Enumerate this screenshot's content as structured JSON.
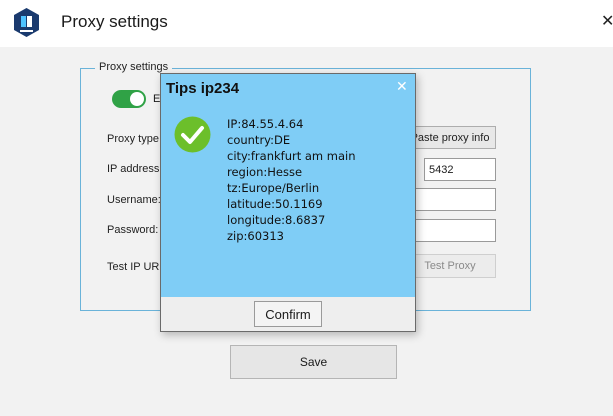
{
  "window": {
    "title": "Proxy settings",
    "close_glyph": "✕"
  },
  "groupbox": {
    "legend": "Proxy settings"
  },
  "form": {
    "toggle_label": "E",
    "toggle_on": true,
    "proxy_type_label": "Proxy type",
    "paste_button": "Paste proxy info",
    "ip_label": "IP address",
    "port_value": "5432",
    "username_label": "Username:",
    "password_label": "Password:",
    "test_url_label": "Test IP URL",
    "test_button": "Test Proxy"
  },
  "save_button": "Save",
  "dialog": {
    "title": "Tips ip234",
    "close_glyph": "✕",
    "icon": "success-check-icon",
    "lines": [
      "IP:84.55.4.64",
      "country:DE",
      "city:frankfurt am main",
      "region:Hesse",
      "tz:Europe/Berlin",
      "latitude:50.1169",
      "longitude:8.6837",
      "zip:60313"
    ],
    "confirm_button": "Confirm"
  },
  "colors": {
    "accent_blue": "#7fcdf6",
    "toggle_green": "#30a246",
    "check_green": "#6cbf2b"
  }
}
